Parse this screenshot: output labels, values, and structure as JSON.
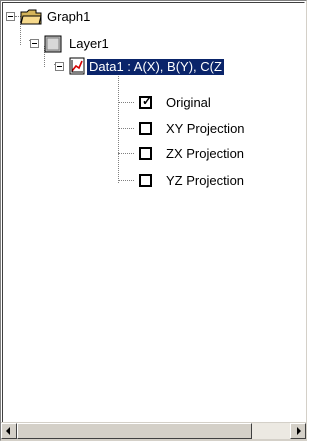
{
  "tree": {
    "root": {
      "label": "Graph1",
      "icon": "folder-icon"
    },
    "layer": {
      "label": "Layer1",
      "icon": "layer-icon"
    },
    "data": {
      "label": "Data1 : A(X), B(Y), C(Z",
      "icon": "plot-icon",
      "selected": true
    },
    "items": [
      {
        "label": "Original",
        "checked": true
      },
      {
        "label": "XY Projection",
        "checked": false
      },
      {
        "label": "ZX Projection",
        "checked": false
      },
      {
        "label": "YZ Projection",
        "checked": false
      }
    ]
  },
  "colors": {
    "selection": "#0a246a",
    "folder": "#d4b45a",
    "layer": "#c0c0c0",
    "plot": "#d40000"
  }
}
